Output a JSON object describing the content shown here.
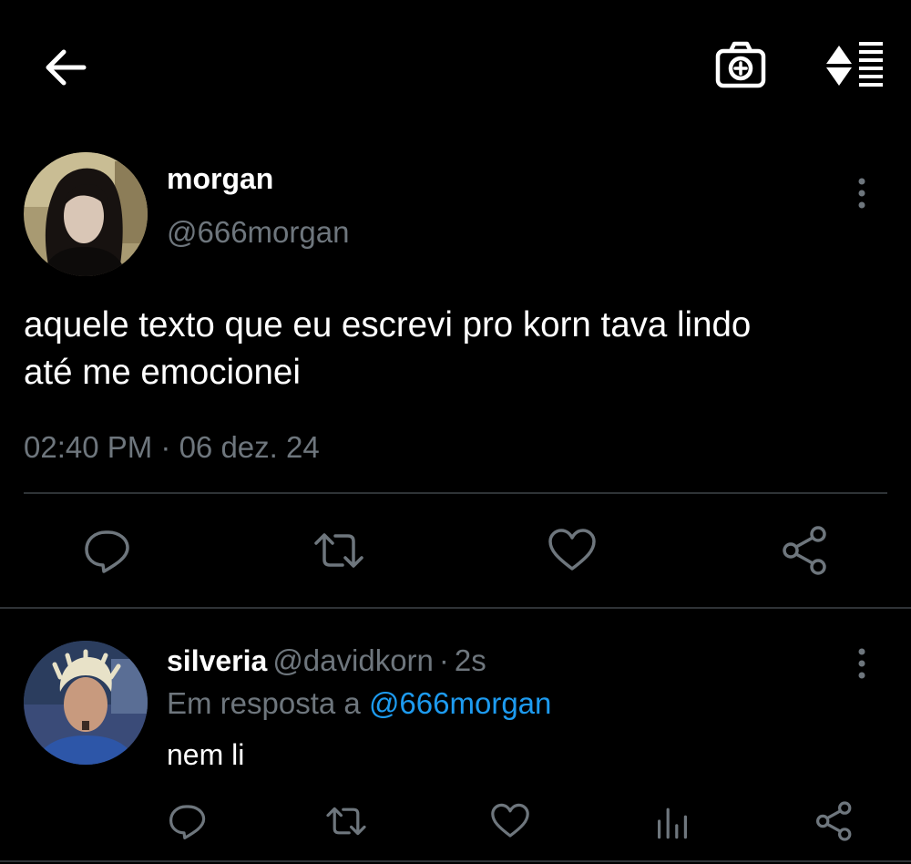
{
  "header": {
    "back_icon": "arrow-left-icon",
    "camera_icon": "camera-add-icon",
    "sort_icon": "sort-list-icon"
  },
  "tweet": {
    "display_name": "morgan",
    "handle": "@666morgan",
    "text_line1": "aquele texto que eu escrevi pro korn tava lindo",
    "text_line2": "até me emocionei",
    "timestamp": "02:40 PM · 06 dez. 24",
    "actions": [
      "reply-icon",
      "retweet-icon",
      "like-icon",
      "share-icon"
    ]
  },
  "reply": {
    "display_name": "silveria",
    "handle": "@davidkorn",
    "separator": "·",
    "time": "2s",
    "replying_to_prefix": "Em resposta a",
    "replying_to_handle": "@666morgan",
    "text": "nem li",
    "actions": [
      "reply-icon",
      "retweet-icon",
      "like-icon",
      "stats-icon",
      "share-icon"
    ]
  },
  "colors": {
    "background": "#000000",
    "text": "#ffffff",
    "secondary": "#6e767d",
    "link": "#1d9bf0",
    "divider": "#2f3336"
  }
}
